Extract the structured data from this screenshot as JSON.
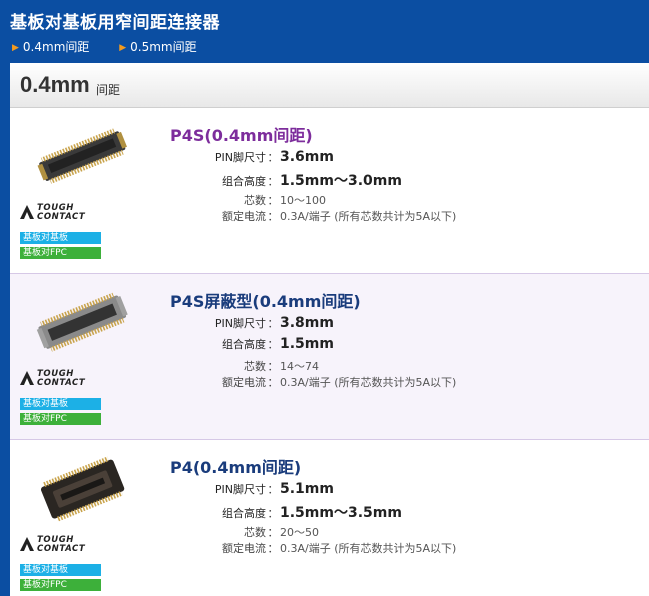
{
  "header": {
    "title": "基板对基板用窄间距连接器",
    "links": [
      {
        "label": "0.4mm间距"
      },
      {
        "label": "0.5mm间距"
      }
    ]
  },
  "section": {
    "pitch_big": "0.4mm",
    "pitch_small": "间距"
  },
  "products": [
    {
      "name": "P4S(0.4mm间距)",
      "name_color": "#7d2d9c",
      "tags": [
        "基板对基板",
        "基板对FPC"
      ],
      "logo_text": [
        "TOUGH",
        "CONTACT"
      ],
      "specs": {
        "pin_label": "PIN脚尺寸",
        "pin_value": "3.6mm",
        "height_label": "组合高度",
        "height_value": "1.5mm～3.0mm",
        "cores_label": "芯数",
        "cores_value": "10～100",
        "current_label": "额定电流",
        "current_value": "0.3A/端子 (所有芯数共计为5A以下)"
      }
    },
    {
      "name": "P4S屏蔽型(0.4mm间距)",
      "name_color": "#1a3c7c",
      "tags": [
        "基板对基板",
        "基板对FPC"
      ],
      "logo_text": [
        "TOUGH",
        "CONTACT"
      ],
      "specs": {
        "pin_label": "PIN脚尺寸",
        "pin_value": "3.8mm",
        "height_label": "组合高度",
        "height_value": "1.5mm",
        "cores_label": "芯数",
        "cores_value": "14～74",
        "current_label": "额定电流",
        "current_value": "0.3A/端子 (所有芯数共计为5A以下)"
      }
    },
    {
      "name": "P4(0.4mm间距)",
      "name_color": "#1a3c7c",
      "tags": [
        "基板对基板",
        "基板对FPC"
      ],
      "logo_text": [
        "TOUGH",
        "CONTACT"
      ],
      "specs": {
        "pin_label": "PIN脚尺寸",
        "pin_value": "5.1mm",
        "height_label": "组合高度",
        "height_value": "1.5mm～3.5mm",
        "cores_label": "芯数",
        "cores_value": "20～50",
        "current_label": "额定电流",
        "current_value": "0.3A/端子 (所有芯数共计为5A以下)"
      }
    }
  ]
}
